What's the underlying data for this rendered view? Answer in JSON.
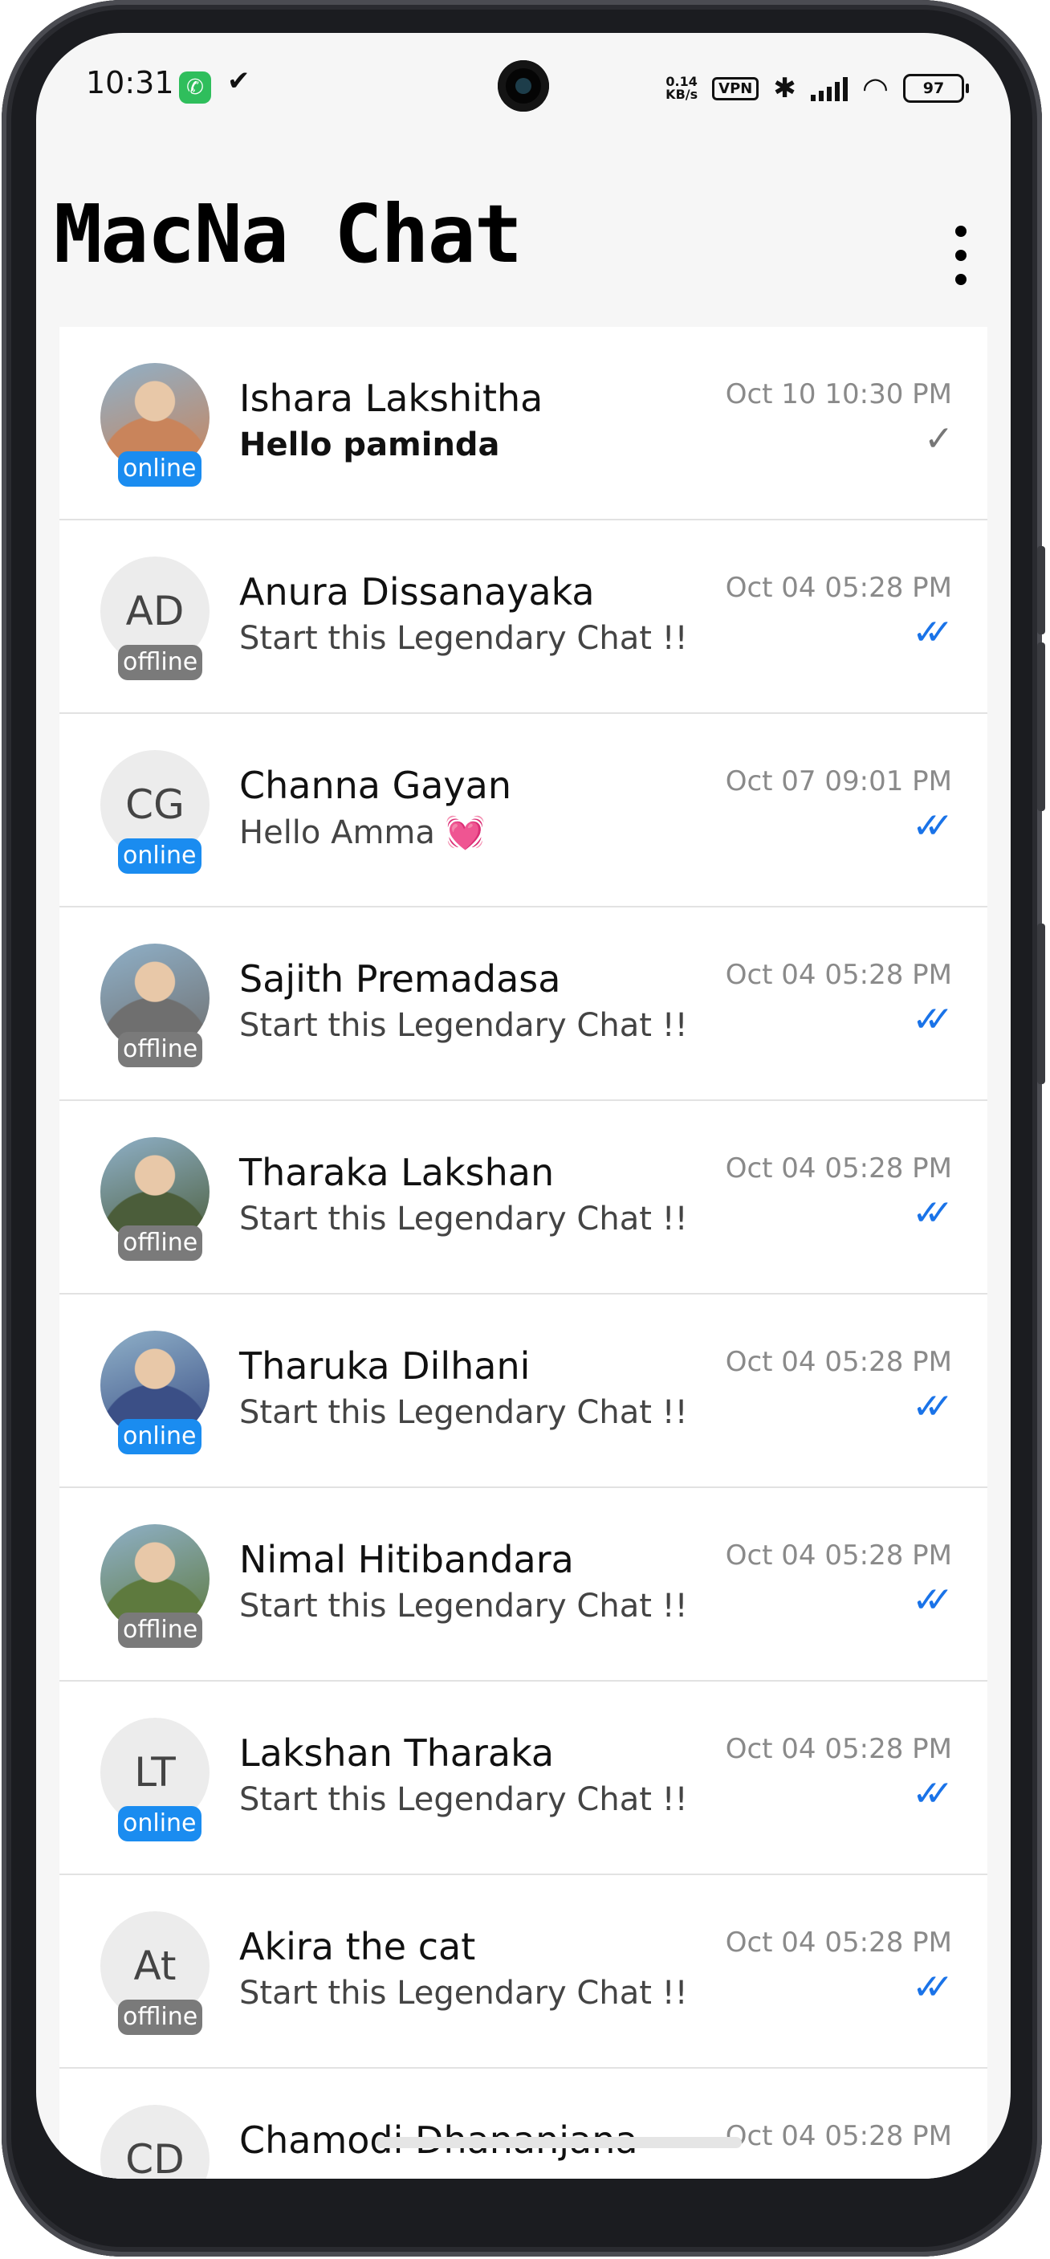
{
  "status_bar": {
    "time": "10:31",
    "app_icon": "whatsapp-icon",
    "network_speed": "0.14\nKB/s",
    "vpn": "VPN",
    "battery": "97"
  },
  "header": {
    "title": "MacNa Chat",
    "menu_icon": "more-vert-icon"
  },
  "colors": {
    "online": "#1a8cf0",
    "offline": "#7a7a7a",
    "read_tick": "#1a73e8",
    "sent_tick": "#777777"
  },
  "chats": [
    {
      "initials": "",
      "avatar": "photo",
      "status": "online",
      "name": "Ishara Lakshitha",
      "message": "Hello paminda",
      "message_bold": true,
      "time": "Oct 10 10:30 PM",
      "tick": "✓",
      "tick_type": "single"
    },
    {
      "initials": "AD",
      "avatar": "initials",
      "status": "offline",
      "name": "Anura Dissanayaka",
      "message": "Start this Legendary Chat !!",
      "message_bold": false,
      "time": "Oct 04 05:28 PM",
      "tick": "✓✓",
      "tick_type": "double"
    },
    {
      "initials": "CG",
      "avatar": "initials",
      "status": "online",
      "name": "Channa Gayan",
      "message": "Hello Amma 💓",
      "message_bold": false,
      "time": "Oct 07 09:01 PM",
      "tick": "✓✓",
      "tick_type": "double"
    },
    {
      "initials": "",
      "avatar": "photo",
      "status": "offline",
      "name": "Sajith Premadasa",
      "message": "Start this Legendary Chat !!",
      "message_bold": false,
      "time": "Oct 04 05:28 PM",
      "tick": "✓✓",
      "tick_type": "double"
    },
    {
      "initials": "",
      "avatar": "photo",
      "status": "offline",
      "name": "Tharaka Lakshan",
      "message": "Start this Legendary Chat !!",
      "message_bold": false,
      "time": "Oct 04 05:28 PM",
      "tick": "✓✓",
      "tick_type": "double"
    },
    {
      "initials": "",
      "avatar": "photo",
      "status": "online",
      "name": "Tharuka Dilhani",
      "message": "Start this Legendary Chat !!",
      "message_bold": false,
      "time": "Oct 04 05:28 PM",
      "tick": "✓✓",
      "tick_type": "double"
    },
    {
      "initials": "",
      "avatar": "photo",
      "status": "offline",
      "name": "Nimal Hitibandara",
      "message": "Start this Legendary Chat !!",
      "message_bold": false,
      "time": "Oct 04 05:28 PM",
      "tick": "✓✓",
      "tick_type": "double"
    },
    {
      "initials": "LT",
      "avatar": "initials",
      "status": "online",
      "name": "Lakshan Tharaka",
      "message": "Start this Legendary Chat !!",
      "message_bold": false,
      "time": "Oct 04 05:28 PM",
      "tick": "✓✓",
      "tick_type": "double"
    },
    {
      "initials": "At",
      "avatar": "initials",
      "status": "offline",
      "name": "Akira the cat",
      "message": "Start this Legendary Chat !!",
      "message_bold": false,
      "time": "Oct 04 05:28 PM",
      "tick": "✓✓",
      "tick_type": "double"
    },
    {
      "initials": "CD",
      "avatar": "initials",
      "status": "",
      "name": "Chamodi Dhananjana",
      "message": "",
      "message_bold": false,
      "time": "Oct 04 05:28 PM",
      "tick": "",
      "tick_type": ""
    }
  ]
}
